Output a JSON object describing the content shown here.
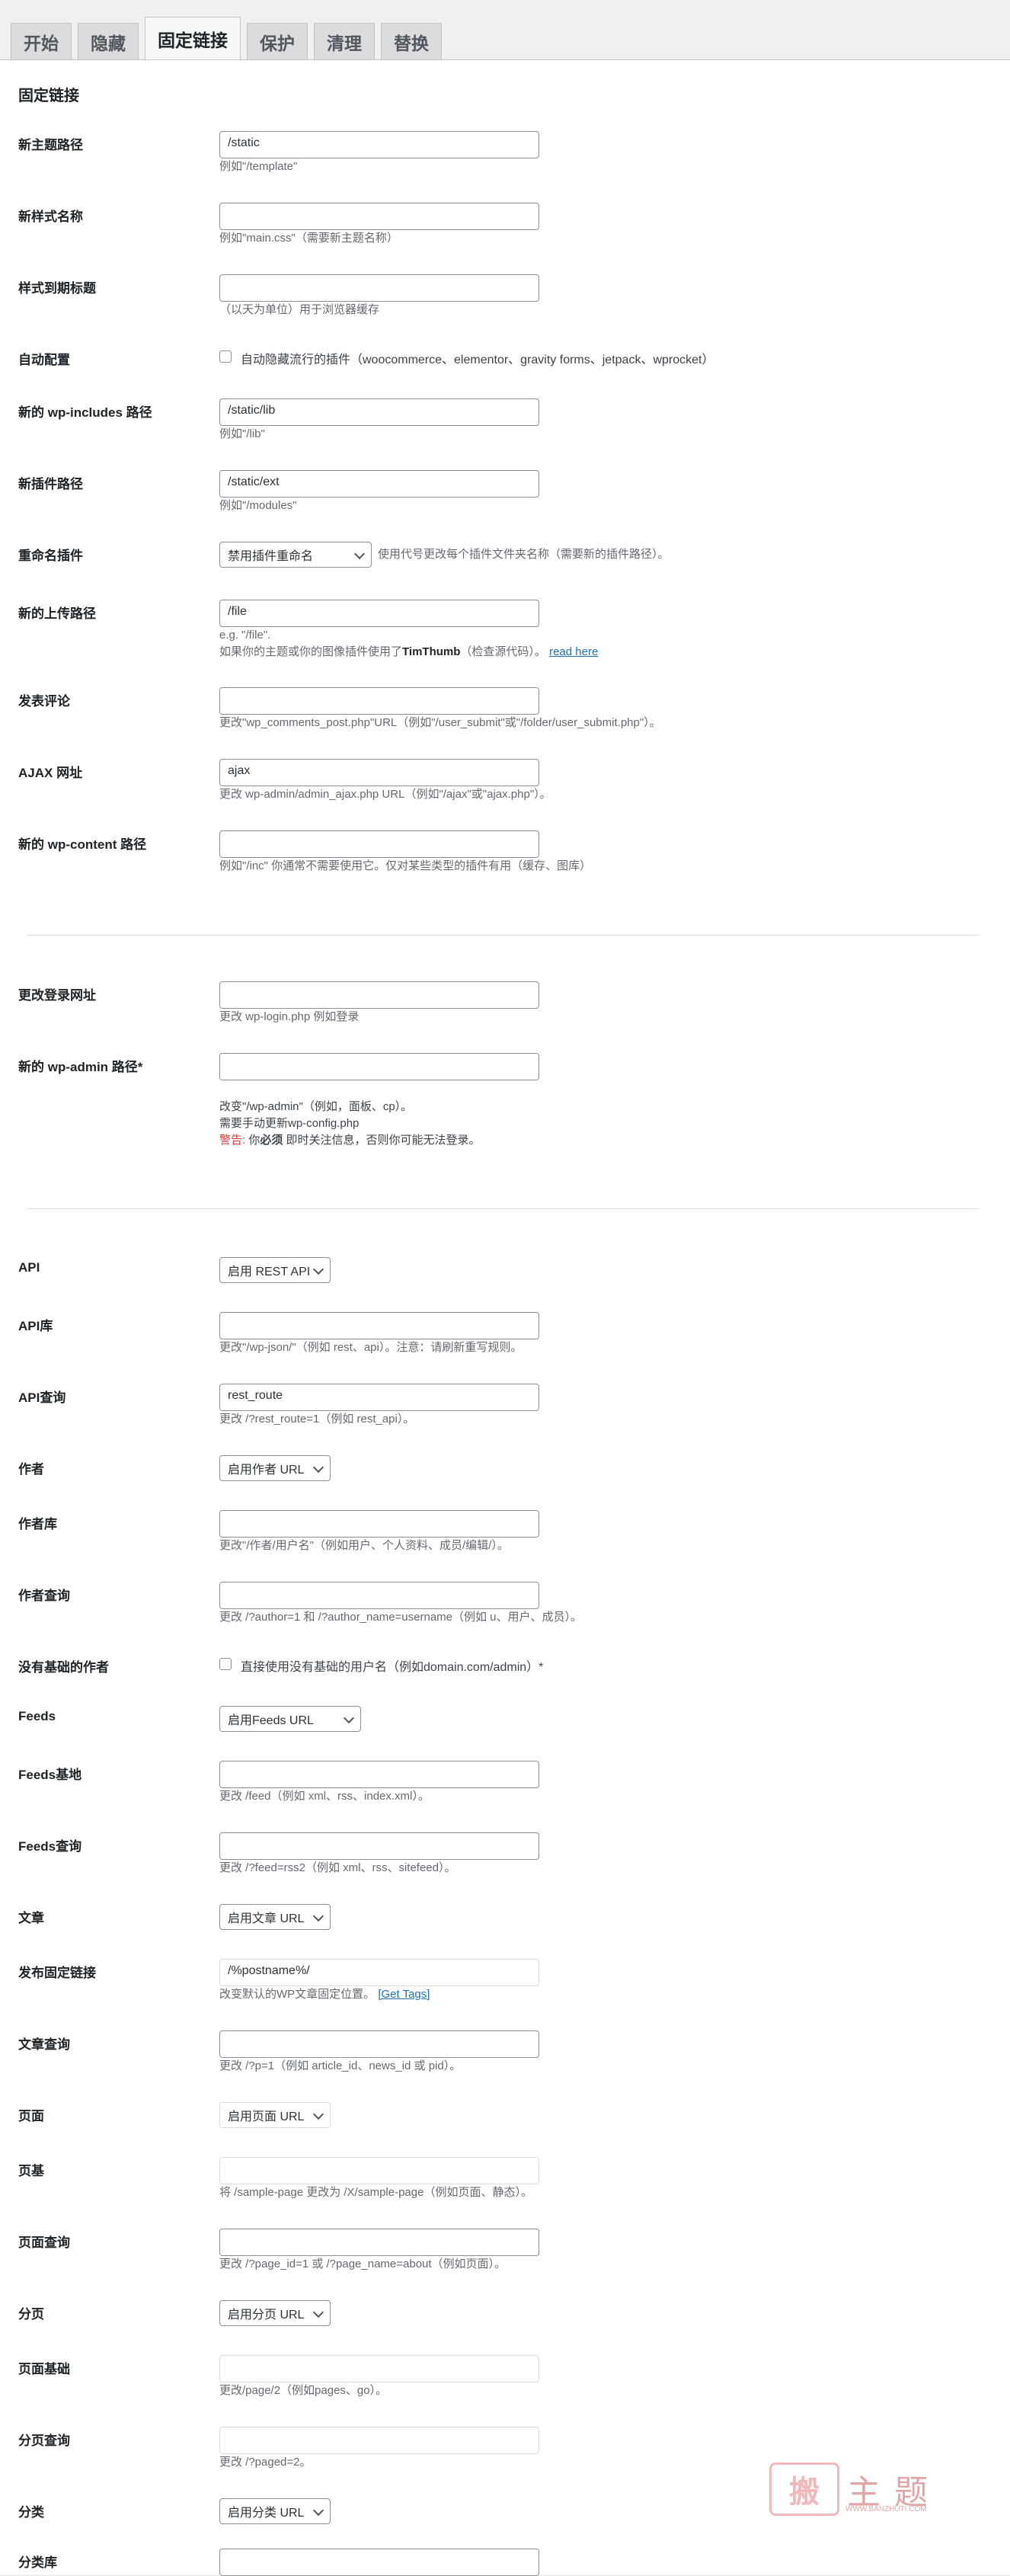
{
  "tabs": [
    "开始",
    "隐藏",
    "固定链接",
    "保护",
    "清理",
    "替换"
  ],
  "active_tab": "固定链接",
  "panel_title": "固定链接",
  "rows": {
    "theme_path": {
      "label": "新主题路径",
      "value": "/static",
      "desc": "例如\"/template\""
    },
    "style_name": {
      "label": "新样式名称",
      "value": "",
      "desc": "例如\"main.css\"（需要新主题名称）"
    },
    "style_expiry": {
      "label": "样式到期标题",
      "value": "",
      "desc": "（以天为单位）用于浏览器缓存"
    },
    "auto_config": {
      "label": "自动配置",
      "checkbox": "自动隐藏流行的插件（woocommerce、elementor、gravity forms、jetpack、wprocket）"
    },
    "includes_path": {
      "label": "新的 wp-includes 路径",
      "value": "/static/lib",
      "desc": "例如\"/lib\""
    },
    "plugin_path": {
      "label": "新插件路径",
      "value": "/static/ext",
      "desc": "例如\"/modules\""
    },
    "rename_plugins": {
      "label": "重命名插件",
      "select": "禁用插件重命名",
      "desc": "使用代号更改每个插件文件夹名称（需要新的插件路径）。"
    },
    "upload_path": {
      "label": "新的上传路径",
      "value": "/file",
      "desc1": "e.g. \"/file\".",
      "desc2a": "如果你的主题或你的图像插件使用了",
      "desc2b": "TimThumb",
      "desc2c": "（检查源代码）。",
      "link": "read here"
    },
    "comments": {
      "label": "发表评论",
      "value": "",
      "desc": "更改\"wp_comments_post.php\"URL（例如\"/user_submit\"或\"/folder/user_submit.php\"）。"
    },
    "ajax": {
      "label": "AJAX 网址",
      "value": "ajax",
      "desc": "更改 wp-admin/admin_ajax.php URL（例如\"/ajax\"或\"ajax.php\"）。"
    },
    "content_path": {
      "label": "新的 wp-content 路径",
      "value": "",
      "desc": "例如\"/inc\" 你通常不需要使用它。仅对某些类型的插件有用（缓存、图库）"
    },
    "login_url": {
      "label": "更改登录网址",
      "value": "",
      "desc": "更改 wp-login.php 例如登录"
    },
    "admin_path": {
      "label": "新的 wp-admin 路径*",
      "value": "",
      "desc1": "改变\"/wp-admin\"（例如，面板、cp）。",
      "desc2": "需要手动更新wp-config.php",
      "warn": "警告:",
      "desc3a": " 你",
      "desc3b": "必须",
      "desc3c": " 即时关注信息，否则你可能无法登录。"
    },
    "api": {
      "label": "API",
      "select": "启用 REST API"
    },
    "api_base": {
      "label": "API库",
      "value": "",
      "desc": "更改\"/wp-json/\"（例如 rest、api）。注意：请刷新重写规则。"
    },
    "api_query": {
      "label": "API查询",
      "value": "rest_route",
      "desc": "更改 /?rest_route=1（例如 rest_api）。"
    },
    "author": {
      "label": "作者",
      "select": "启用作者 URL"
    },
    "author_base": {
      "label": "作者库",
      "value": "",
      "desc": "更改\"/作者/用户名\"（例如用户、个人资料、成员/编辑/）。"
    },
    "author_query": {
      "label": "作者查询",
      "value": "",
      "desc": "更改 /?author=1 和 /?author_name=username（例如 u、用户、成员）。"
    },
    "no_base_author": {
      "label": "没有基础的作者",
      "checkbox": "直接使用没有基础的用户名（例如domain.com/admin）*"
    },
    "feeds": {
      "label": "Feeds",
      "select": "启用Feeds URL"
    },
    "feeds_base": {
      "label": "Feeds基地",
      "value": "",
      "desc": "更改 /feed（例如 xml、rss、index.xml）。"
    },
    "feeds_query": {
      "label": "Feeds查询",
      "value": "",
      "desc": "更改 /?feed=rss2（例如 xml、rss、sitefeed）。"
    },
    "post": {
      "label": "文章",
      "select": "启用文章 URL"
    },
    "permalink": {
      "label": "发布固定链接",
      "value": "/%postname%/",
      "desc": "改变默认的WP文章固定位置。",
      "link": "[Get Tags]"
    },
    "post_query": {
      "label": "文章查询",
      "value": "",
      "desc": "更改 /?p=1（例如 article_id、news_id 或 pid）。"
    },
    "page": {
      "label": "页面",
      "select": "启用页面 URL"
    },
    "page_base": {
      "label": "页基",
      "value": "",
      "desc": "将 /sample-page 更改为 /X/sample-page（例如页面、静态）。"
    },
    "page_query": {
      "label": "页面查询",
      "value": "",
      "desc": "更改 /?page_id=1 或 /?page_name=about（例如页面）。"
    },
    "paging": {
      "label": "分页",
      "select": "启用分页 URL"
    },
    "paging_base": {
      "label": "页面基础",
      "value": "",
      "desc": "更改/page/2（例如pages、go）。"
    },
    "paging_query": {
      "label": "分页查询",
      "value": "",
      "desc": "更改 /?paged=2。"
    },
    "category": {
      "label": "分类",
      "select": "启用分类 URL"
    },
    "category_base": {
      "label": "分类库",
      "value": ""
    }
  },
  "watermark": {
    "seal": "搬",
    "text": "主题",
    "url": "WWW.BANZHUTI.COM"
  }
}
